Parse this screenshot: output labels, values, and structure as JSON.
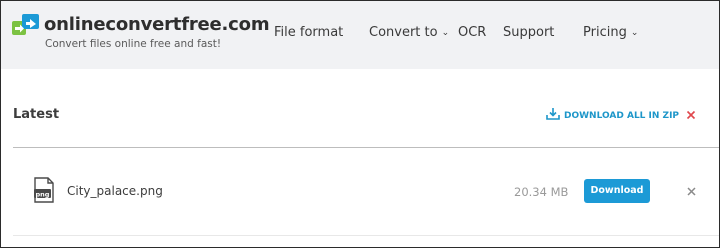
{
  "header": {
    "brand": "onlineconvertfree.com",
    "tagline": "Convert files online free and fast!",
    "nav": [
      {
        "label": "File format",
        "has_dropdown": false
      },
      {
        "label": "Convert to",
        "has_dropdown": true
      },
      {
        "label": "OCR",
        "has_dropdown": false
      },
      {
        "label": "Support",
        "has_dropdown": false
      },
      {
        "label": "Pricing",
        "has_dropdown": true
      }
    ],
    "logo_colors": {
      "blue": "#1c9ad6",
      "green": "#7cc242"
    }
  },
  "latest": {
    "title": "Latest",
    "download_all_label": "DOWNLOAD ALL IN ZIP",
    "close_color": "#e0474c"
  },
  "files": [
    {
      "icon_label": "png",
      "name": "City_palace.png",
      "size": "20.34 MB",
      "download_label": "Download"
    }
  ],
  "colors": {
    "accent": "#1c9ad6",
    "header_bg": "#f1f2f4"
  }
}
